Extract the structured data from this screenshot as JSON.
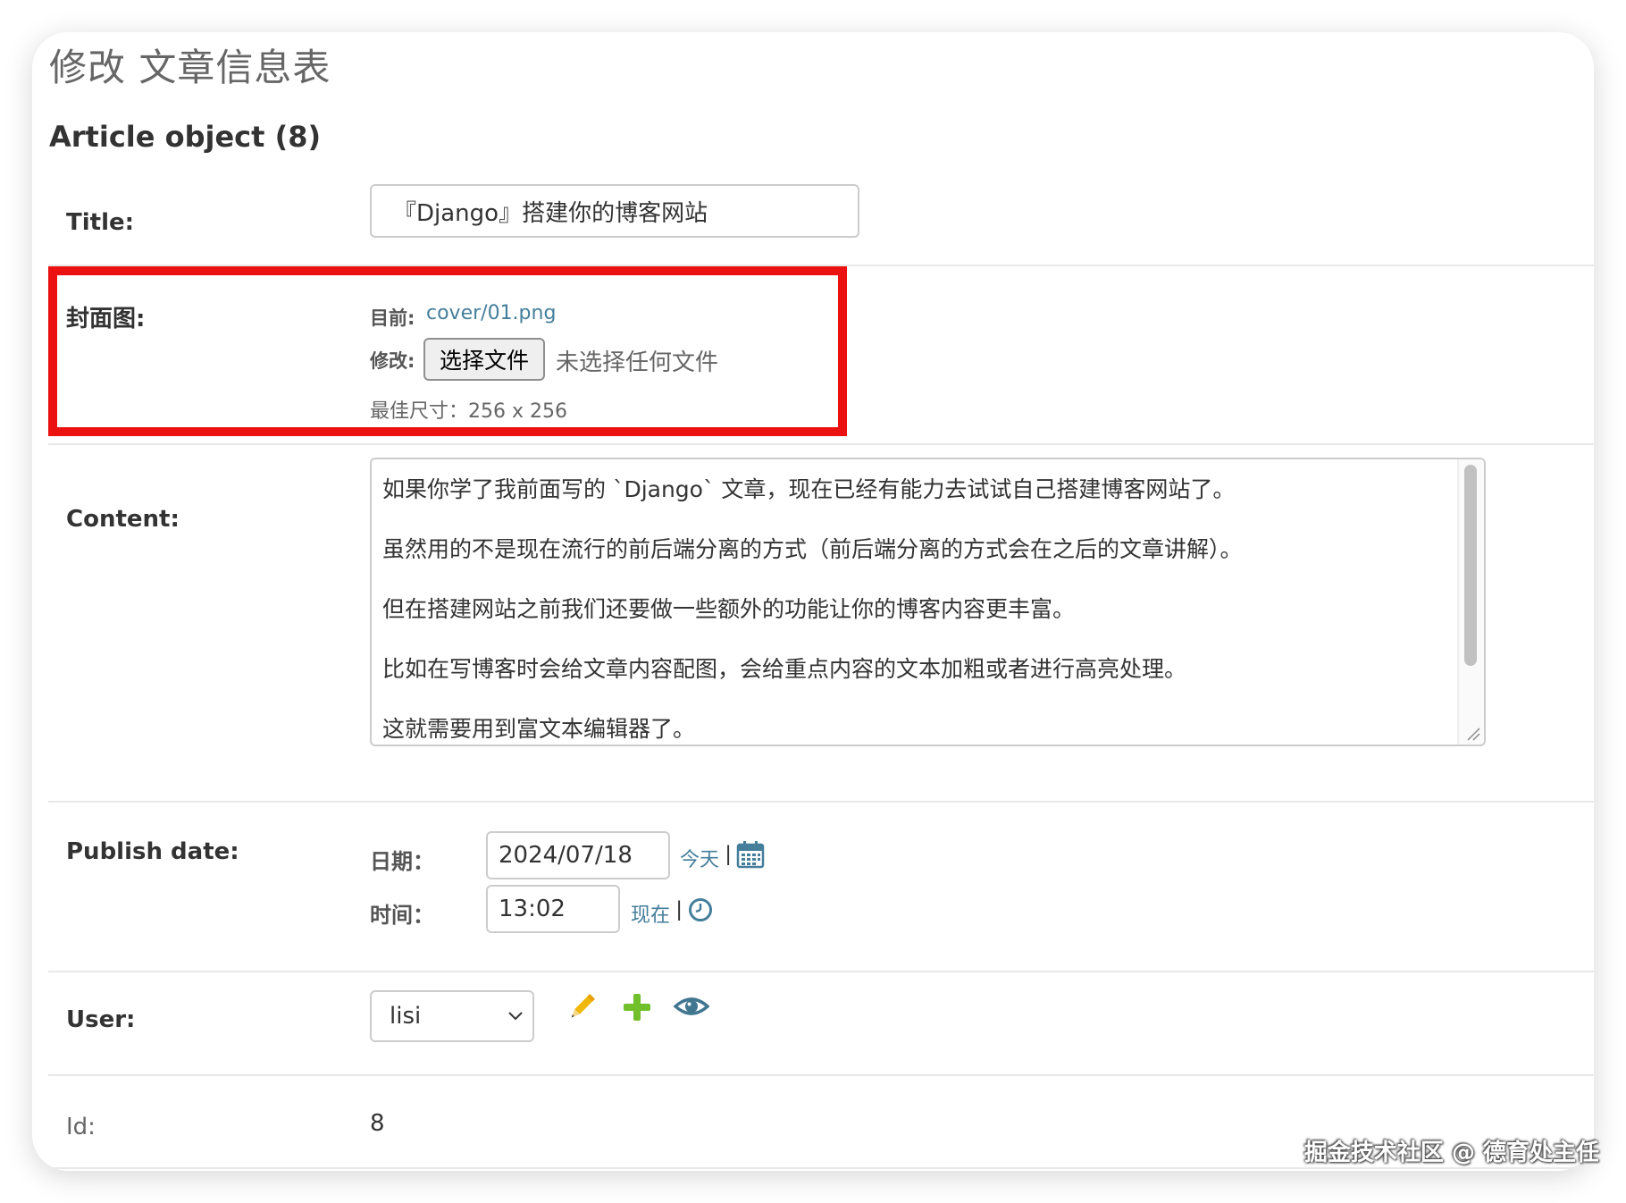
{
  "page": {
    "title": "修改 文章信息表",
    "object_title": "Article object (8)"
  },
  "title_field": {
    "label": "Title:",
    "value": "『Django』搭建你的博客网站"
  },
  "cover_field": {
    "label": "封面图:",
    "current_label": "目前:",
    "current_file": "cover/01.png",
    "change_label": "修改:",
    "choose_button": "选择文件",
    "no_file_text": "未选择任何文件",
    "help_text": "最佳尺寸：256 x 256",
    "highlight_color": "#ec1111"
  },
  "content_field": {
    "label": "Content:",
    "paragraphs": [
      "如果你学了我前面写的 `Django` 文章，现在已经有能力去试试自己搭建博客网站了。",
      "虽然用的不是现在流行的前后端分离的方式（前后端分离的方式会在之后的文章讲解）。",
      "但在搭建网站之前我们还要做一些额外的功能让你的博客内容更丰富。",
      "比如在写博客时会给文章内容配图，会给重点内容的文本加粗或者进行高亮处理。",
      "这就需要用到富文本编辑器了。"
    ]
  },
  "publish_date_field": {
    "label": "Publish date:",
    "date_label": "日期：",
    "date_value": "2024/07/18",
    "today_link": "今天",
    "date_separator": "|",
    "calendar_icon": "calendar-icon",
    "time_label": "时间：",
    "time_value": "13:02",
    "now_link": "现在",
    "time_separator": "|",
    "clock_icon": "clock-icon"
  },
  "user_field": {
    "label": "User:",
    "selected": "lisi",
    "edit_icon": "pencil-icon",
    "add_icon": "plus-icon",
    "view_icon": "eye-icon"
  },
  "id_field": {
    "label": "Id:",
    "value": "8"
  },
  "watermark": "掘金技术社区 @ 德育处主任",
  "colors": {
    "link": "#447e9b",
    "pencil": "#efb80b",
    "plus": "#70bf2b",
    "eye": "#417690"
  }
}
